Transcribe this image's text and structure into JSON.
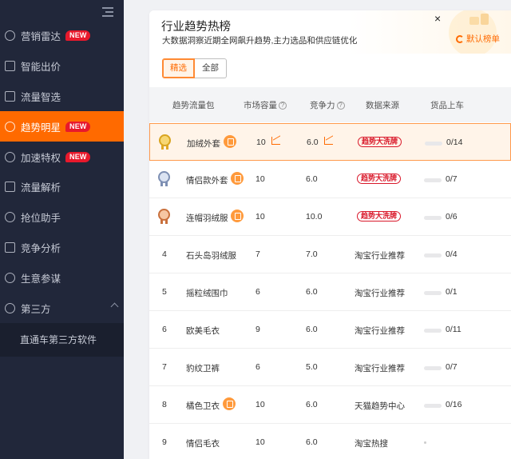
{
  "sidebar": {
    "items": [
      {
        "label": "营销雷达",
        "new": "NEW"
      },
      {
        "label": "智能出价",
        "new": ""
      },
      {
        "label": "流量智选",
        "new": ""
      },
      {
        "label": "趋势明星",
        "new": "NEW",
        "active": true
      },
      {
        "label": "加速特权",
        "new": "NEW"
      },
      {
        "label": "流量解析",
        "new": ""
      },
      {
        "label": "抢位助手",
        "new": ""
      },
      {
        "label": "竞争分析",
        "new": ""
      },
      {
        "label": "生意参谋",
        "new": ""
      },
      {
        "label": "第三方",
        "new": ""
      }
    ],
    "submenu": [
      "直通车第三方软件"
    ]
  },
  "card": {
    "title": "行业趋势热榜",
    "subtitle": "大数据洞察近期全网飙升趋势,主力选品和供应链优化",
    "default_rank": "默认榜单",
    "tabs": [
      "精选",
      "全部"
    ]
  },
  "table": {
    "headers": [
      "趋势流量包",
      "市场容量",
      "竞争力",
      "数据来源",
      "货品上车"
    ],
    "rows": [
      {
        "rank": "1",
        "name": "加绒外套",
        "tag": true,
        "capacity": "10",
        "cap_trend": true,
        "competition": "6.0",
        "comp_trend": true,
        "source": "趋势大洗牌",
        "hot": true,
        "progress": "0/14"
      },
      {
        "rank": "2",
        "name": "情侣款外套",
        "tag": true,
        "capacity": "10",
        "cap_trend": false,
        "competition": "6.0",
        "comp_trend": false,
        "source": "趋势大洗牌",
        "hot": true,
        "progress": "0/7"
      },
      {
        "rank": "3",
        "name": "连帽羽绒服",
        "tag": true,
        "capacity": "10",
        "cap_trend": false,
        "competition": "10.0",
        "comp_trend": false,
        "source": "趋势大洗牌",
        "hot": true,
        "progress": "0/6"
      },
      {
        "rank": "4",
        "name": "石头岛羽绒服",
        "tag": false,
        "capacity": "7",
        "competition": "7.0",
        "source": "淘宝行业推荐",
        "hot": false,
        "progress": "0/4"
      },
      {
        "rank": "5",
        "name": "摇粒绒围巾",
        "tag": false,
        "capacity": "6",
        "competition": "6.0",
        "source": "淘宝行业推荐",
        "hot": false,
        "progress": "0/1"
      },
      {
        "rank": "6",
        "name": "欧美毛衣",
        "tag": false,
        "capacity": "9",
        "competition": "6.0",
        "source": "淘宝行业推荐",
        "hot": false,
        "progress": "0/11"
      },
      {
        "rank": "7",
        "name": "豹纹卫裤",
        "tag": false,
        "capacity": "6",
        "competition": "5.0",
        "source": "淘宝行业推荐",
        "hot": false,
        "progress": "0/7"
      },
      {
        "rank": "8",
        "name": "橘色卫衣",
        "tag": true,
        "capacity": "10",
        "competition": "6.0",
        "source": "天猫趋势中心",
        "hot": false,
        "progress": "0/16"
      },
      {
        "rank": "9",
        "name": "情侣毛衣",
        "tag": false,
        "capacity": "10",
        "competition": "6.0",
        "source": "淘宝热搜",
        "hot": false,
        "progress": ""
      }
    ]
  },
  "colors": {
    "accent": "#ff6a00",
    "sidebar_bg": "#21273a",
    "hot_red": "#d9182a"
  }
}
